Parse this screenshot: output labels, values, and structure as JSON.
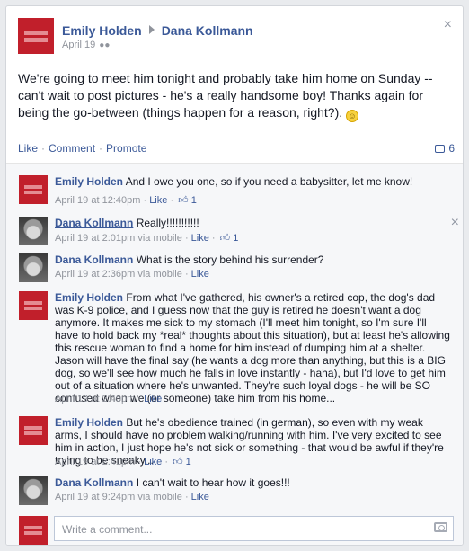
{
  "post": {
    "author": "Emily Holden",
    "target": "Dana Kollmann",
    "date": "April 19",
    "audience_icon": "people-icon",
    "text": "We're going to meet him tonight and probably take him home on Sunday -- can't wait to post pictures - he's a really handsome boy! Thanks again for being the go-between (things happen for a reason, right?).",
    "emoticon": "smiley-icon",
    "close_glyph": "×"
  },
  "actions": {
    "like": "Like",
    "comment": "Comment",
    "promote": "Promote",
    "separator": "·",
    "comment_count": "6"
  },
  "comments": [
    {
      "author": "Emily Holden",
      "text": "And I owe you one, so if you need a babysitter, let me know!",
      "time": "April 19 at 12:40pm",
      "via": "",
      "like": "Like",
      "likes": "1"
    },
    {
      "author": "Dana Kollmann",
      "text": "Really!!!!!!!!!!!",
      "time": "April 19 at 2:01pm",
      "via": "via mobile",
      "like": "Like",
      "likes": "1"
    },
    {
      "author": "Dana Kollmann",
      "text": "What is the story behind his surrender?",
      "time": "April 19 at 2:36pm",
      "via": "via mobile",
      "like": "Like",
      "likes": ""
    },
    {
      "author": "Emily Holden",
      "text": "From what I've gathered, his owner's a retired cop, the dog's dad was K-9 police, and I guess now that the guy is retired he doesn't want a dog anymore. It makes me sick to my stomach (I'll meet him tonight, so I'm sure I'll have to hold back my *real* thoughts about this situation), but at least he's allowing this rescue woman to find a home for him instead of dumping him at a shelter. Jason will have the final say (he wants a dog more than anything, but this is a BIG dog, so we'll see how much he falls in love instantly - haha), but I'd love to get him out of a situation where he's unwanted. They're such loyal dogs - he will be SO confused when we (or someone) take him from his home...",
      "time": "April 19 at 2:40pm",
      "via": "",
      "like": "Like",
      "likes": ""
    },
    {
      "author": "Emily Holden",
      "text": "But he's obedience trained (in german), so even with my weak arms, I should have no problem walking/running with him. I've very excited to see him in action, I just hope he's not sick or something - that would be awful if they're trying to be sneaky...",
      "time": "April 19 at 2:41pm",
      "via": "",
      "like": "Like",
      "likes": "1"
    },
    {
      "author": "Dana Kollmann",
      "text": "I can't wait to hear how it goes!!!",
      "time": "April 19 at 9:24pm",
      "via": "via mobile",
      "like": "Like",
      "likes": ""
    }
  ],
  "composer": {
    "placeholder": "Write a comment...",
    "camera_icon": "camera-icon"
  },
  "colors": {
    "link": "#3b5998",
    "avatar_red": "#c11f2b",
    "meta_gray": "#90949c"
  }
}
